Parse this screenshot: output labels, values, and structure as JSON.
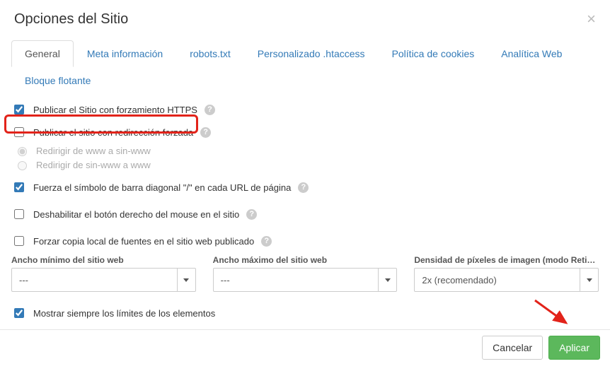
{
  "header": {
    "title": "Opciones del Sitio"
  },
  "tabs": [
    {
      "label": "General",
      "active": true
    },
    {
      "label": "Meta información",
      "active": false
    },
    {
      "label": "robots.txt",
      "active": false
    },
    {
      "label": "Personalizado .htaccess",
      "active": false
    },
    {
      "label": "Política de cookies",
      "active": false
    },
    {
      "label": "Analítica Web",
      "active": false
    },
    {
      "label": "Bloque flotante",
      "active": false
    }
  ],
  "options": {
    "https_force": {
      "label": "Publicar el Sitio con forzamiento HTTPS",
      "checked": true
    },
    "redirect_force": {
      "label": "Publicar el sitio con redirección forzada",
      "checked": false
    },
    "redirect_www_to_non": {
      "label": "Redirigir de www a sin-www",
      "checked": true
    },
    "redirect_non_to_www": {
      "label": "Redirigir de sin-www a www",
      "checked": false
    },
    "trailing_slash": {
      "label": "Fuerza el símbolo de barra diagonal \"/\" en cada URL de página",
      "checked": true
    },
    "disable_right_click": {
      "label": "Deshabilitar el botón derecho del mouse en el sitio",
      "checked": false
    },
    "force_local_fonts": {
      "label": "Forzar copia local de fuentes en el sitio web publicado",
      "checked": false
    },
    "show_boundaries": {
      "label": "Mostrar siempre los límites de los elementos",
      "checked": true
    }
  },
  "fields": {
    "min_width": {
      "label": "Ancho mínimo del sitio web",
      "value": "---"
    },
    "max_width": {
      "label": "Ancho máximo del sitio web",
      "value": "---"
    },
    "pixel_density": {
      "label": "Densidad de píxeles de imagen (modo Reti…",
      "value": "2x (recomendado)"
    }
  },
  "footer": {
    "cancel": "Cancelar",
    "apply": "Aplicar"
  },
  "icons": {
    "help": "?",
    "close": "×"
  }
}
